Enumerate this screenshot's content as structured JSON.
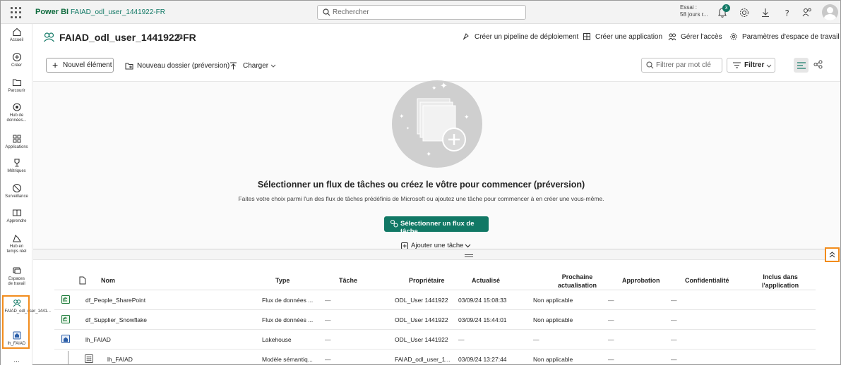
{
  "topbar": {
    "brand": "Power BI",
    "workspace_crumb": "FAIAD_odl_user_1441922-FR",
    "search_placeholder": "Rechercher",
    "trial_line1": "Essai :",
    "trial_line2": "58 jours r...",
    "notification_count": "3"
  },
  "rail": {
    "items": [
      {
        "label": "Accueil",
        "icon": "home-icon"
      },
      {
        "label": "Créer",
        "icon": "create-icon"
      },
      {
        "label": "Parcourir",
        "icon": "folder-icon"
      },
      {
        "label": "Hub de données...",
        "icon": "data-hub-icon"
      },
      {
        "label": "Applications",
        "icon": "apps-icon"
      },
      {
        "label": "Métriques",
        "icon": "trophy-icon"
      },
      {
        "label": "Surveillance",
        "icon": "monitor-icon"
      },
      {
        "label": "Apprendre",
        "icon": "book-icon"
      },
      {
        "label": "Hub en temps réel",
        "icon": "realtime-icon"
      },
      {
        "label": "Espaces de travail",
        "icon": "workspaces-icon"
      },
      {
        "label": "FAIAD_odl_user_1441...",
        "icon": "workspace-icon"
      },
      {
        "label": "lh_FAIAD",
        "icon": "lakehouse-icon"
      }
    ],
    "more": "..."
  },
  "header": {
    "title": "FAIAD_odl_user_1441922-FR",
    "actions": {
      "pipeline": "Créer un pipeline de déploiement",
      "app": "Créer une application",
      "access": "Gérer l'accès",
      "settings": "Paramètres d'espace de travail"
    }
  },
  "toolbar": {
    "new_item": "Nouvel élément",
    "new_folder": "Nouveau dossier (préversion)",
    "upload": "Charger",
    "filter_placeholder": "Filtrer par mot clé",
    "filter": "Filtrer"
  },
  "empty_state": {
    "title": "Sélectionner un flux de tâches ou créez le vôtre pour commencer (préversion)",
    "subtitle": "Faites votre choix parmi l'un des flux de tâches prédéfinis de Microsoft ou ajoutez une tâche pour commencer à en créer une vous-même.",
    "button": "Sélectionner un flux de tâche",
    "add_task": "Ajouter une tâche"
  },
  "table": {
    "headers": {
      "name": "Nom",
      "type": "Type",
      "task": "Tâche",
      "owner": "Propriétaire",
      "refreshed": "Actualisé",
      "next_refresh_1": "Prochaine",
      "next_refresh_2": "actualisation",
      "approval": "Approbation",
      "sensitivity": "Confidentialité",
      "included_1": "Inclus dans",
      "included_2": "l'application"
    },
    "rows": [
      {
        "name": "df_People_SharePoint",
        "type": "Flux de données ...",
        "task": "—",
        "owner": "ODL_User 1441922",
        "refreshed": "03/09/24 15:08:33",
        "next": "Non applicable",
        "approval": "—",
        "sensitivity": "—",
        "icon": "dataflow-icon"
      },
      {
        "name": "df_Supplier_Snowflake",
        "type": "Flux de données ...",
        "task": "—",
        "owner": "ODL_User 1441922",
        "refreshed": "03/09/24 15:44:01",
        "next": "Non applicable",
        "approval": "—",
        "sensitivity": "—",
        "icon": "dataflow-icon"
      },
      {
        "name": "lh_FAIAD",
        "type": "Lakehouse",
        "task": "—",
        "owner": "ODL_User 1441922",
        "refreshed": "—",
        "next": "—",
        "approval": "—",
        "sensitivity": "—",
        "icon": "lakehouse-icon"
      },
      {
        "name": "lh_FAIAD",
        "type": "Modèle sémantiq...",
        "task": "—",
        "owner": "FAIAD_odl_user_1...",
        "refreshed": "03/09/24 13:27:44",
        "next": "Non applicable",
        "approval": "—",
        "sensitivity": "—",
        "icon": "semantic-model-icon"
      }
    ]
  },
  "colors": {
    "accent": "#117865",
    "brand": "#0f6b3e",
    "highlight": "#f28c1c"
  }
}
